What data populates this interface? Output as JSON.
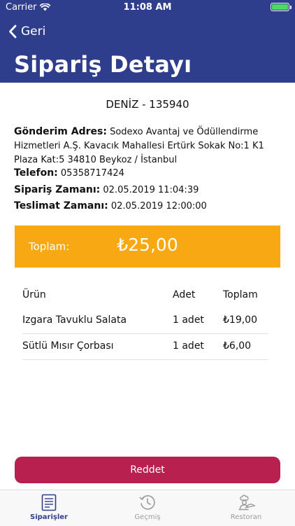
{
  "status_bar": {
    "carrier": "Carrier",
    "time": "11:08 AM",
    "battery_level": 1.0
  },
  "nav": {
    "back_label": "Geri",
    "title": "Sipariş Detayı"
  },
  "order": {
    "customer": "DENİZ  - 135940",
    "address_label": "Gönderim Adres:",
    "address": "Sodexo Avantaj ve Ödüllendirme Hizmetleri A.Ş. Kavacık Mahallesi Ertürk Sokak No:1 K1 Plaza Kat:5 34810 Beykoz / İstanbul",
    "phone_label": "Telefon:",
    "phone": "05358717424",
    "order_time_label": "Sipariş Zamanı:",
    "order_time": "02.05.2019 11:04:39",
    "delivery_time_label": "Teslimat Zamanı:",
    "delivery_time": "02.05.2019 12:00:00"
  },
  "total": {
    "label": "Toplam:",
    "value": "₺25,00"
  },
  "items": {
    "headers": {
      "name": "Ürün",
      "qty": "Adet",
      "total": "Toplam"
    },
    "rows": [
      {
        "name": "Izgara Tavuklu Salata",
        "qty": "1 adet",
        "total": "₺19,00"
      },
      {
        "name": "Sütlü Mısır Çorbası",
        "qty": "1 adet",
        "total": "₺6,00"
      }
    ]
  },
  "actions": {
    "reject_label": "Reddet"
  },
  "tabs": [
    {
      "label": "Siparişler",
      "icon": "list-document-icon",
      "active": true
    },
    {
      "label": "Geçmiş",
      "icon": "history-clock-icon",
      "active": false
    },
    {
      "label": "Restoran",
      "icon": "chef-icon",
      "active": false
    }
  ],
  "colors": {
    "nav": "#2f3e8c",
    "total_bar": "#f7a813",
    "reject_button": "#b8214f",
    "battery": "#4cd964"
  }
}
